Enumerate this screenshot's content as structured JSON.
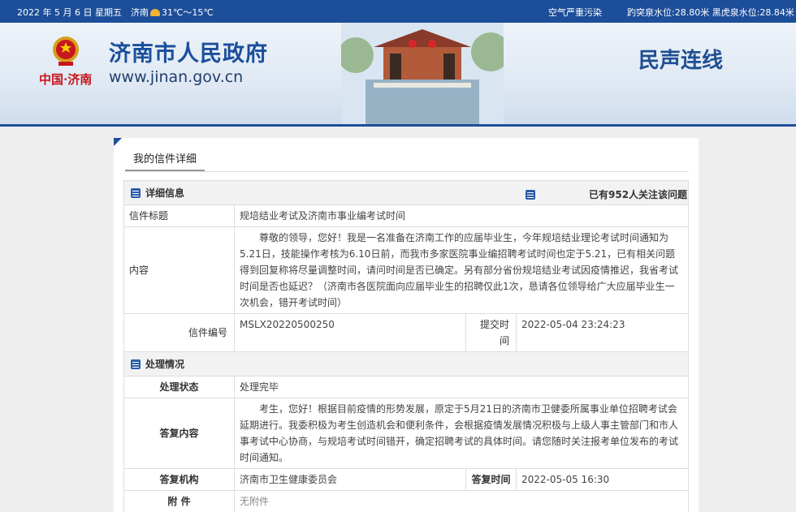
{
  "topbar": {
    "date": "2022 年 5 月 6 日 星期五",
    "city": "济南",
    "weather_icon": "sun-cloud-icon",
    "temperature": "31℃～15℃",
    "air": "空气严重污染",
    "water_level": "趵突泉水位:28.80米 黑虎泉水位:28.84米"
  },
  "header": {
    "emblem_caption": "中国·济南",
    "site_title": "济南市人民政府",
    "site_url": "www.jinan.gov.cn",
    "section_name": "民声连线"
  },
  "tab": {
    "label": "我的信件详细"
  },
  "details": {
    "section_title": "详细信息",
    "attention_text": "已有952人关注该问题",
    "title_label": "信件标题",
    "title_value": "规培结业考试及济南市事业编考试时间",
    "content_label": "内容",
    "content_value": "尊敬的领导，您好！我是一名准备在济南工作的应届毕业生，今年规培结业理论考试时间通知为5.21日，技能操作考核为6.10日前，而我市多家医院事业编招聘考试时间也定于5.21，已有相关问题得到回复称将尽量调整时间，请问时间是否已确定。另有部分省份规培结业考试因疫情推迟，我省考试时间是否也延迟？（济南市各医院面向应届毕业生的招聘仅此1次，恳请各位领导给广大应届毕业生一次机会，错开考试时间）",
    "number_label": "信件编号",
    "number_value": "MSLX20220500250",
    "submit_label": "提交时间",
    "submit_value": "2022-05-04 23:24:23"
  },
  "handling": {
    "section_title": "处理情况",
    "status_label": "处理状态",
    "status_value": "处理完毕",
    "reply_label": "答复内容",
    "reply_value": "考生，您好！根据目前疫情的形势发展，原定于5月21日的济南市卫健委所属事业单位招聘考试会延期进行。我委积极为考生创造机会和便利条件，会根据疫情发展情况积极与上级人事主管部门和市人事考试中心协商，与规培考试时间错开，确定招聘考试的具体时间。请您随时关注报考单位发布的考试时间通知。",
    "org_label": "答复机构",
    "org_value": "济南市卫生健康委员会",
    "time_label": "答复时间",
    "time_value": "2022-05-05 16:30",
    "attach_label": "附 件",
    "attach_value": "无附件"
  }
}
